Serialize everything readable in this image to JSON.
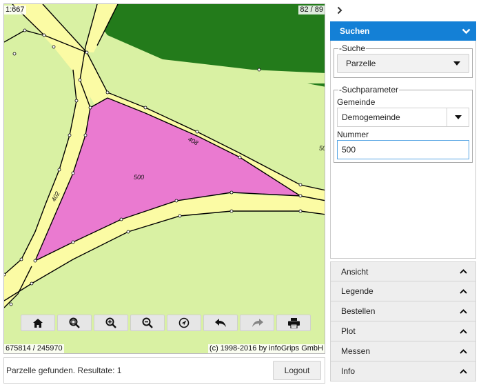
{
  "map": {
    "scale": "1:667",
    "page_counter": "82 / 89",
    "coordinates": "675814 / 245970",
    "copyright": "(c) 1998-2016 by infoGrips GmbH",
    "parcel_labels": {
      "main": "500",
      "road_diag": "408",
      "road_left": "402",
      "edge": "50"
    },
    "colors": {
      "background": "#d9f1a3",
      "forest": "#237b1b",
      "road": "#fbfba4",
      "selected_parcel": "#ea7ad0",
      "outline": "#000000"
    }
  },
  "toolbar": {
    "buttons": [
      {
        "name": "home-button",
        "icon": "home-icon"
      },
      {
        "name": "zoom-box-button",
        "icon": "zoom-box-icon"
      },
      {
        "name": "zoom-in-button",
        "icon": "zoom-in-icon"
      },
      {
        "name": "zoom-out-button",
        "icon": "zoom-out-icon"
      },
      {
        "name": "locate-button",
        "icon": "location-arrow-icon"
      },
      {
        "name": "undo-button",
        "icon": "undo-arrow-icon"
      },
      {
        "name": "redo-button",
        "icon": "redo-arrow-icon",
        "disabled": true
      },
      {
        "name": "print-button",
        "icon": "printer-icon"
      }
    ]
  },
  "status": {
    "message": "Parzelle gefunden. Resultate: 1",
    "logout_label": "Logout"
  },
  "panel": {
    "accent": "#1480d6",
    "collapse_icon": "chevron-right-icon",
    "search": {
      "title": "Suchen",
      "fieldset_suche_legend": "-Suche",
      "suche_value": "Parzelle",
      "fieldset_param_legend": "-Suchparameter",
      "gemeinde_label": "Gemeinde",
      "gemeinde_value": "Demogemeinde",
      "nummer_label": "Nummer",
      "nummer_value": "500"
    },
    "accordion": [
      "Ansicht",
      "Legende",
      "Bestellen",
      "Plot",
      "Messen",
      "Info"
    ]
  }
}
